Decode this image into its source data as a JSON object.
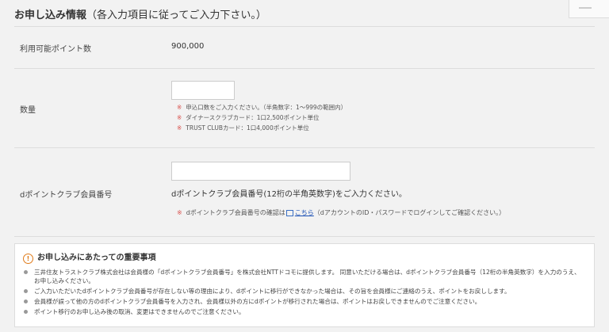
{
  "header": {
    "title": "お申し込み情報",
    "note": "（各入力項目に従ってご入力下さい。）"
  },
  "form": {
    "points": {
      "label": "利用可能ポイント数",
      "value": "900,000"
    },
    "quantity": {
      "label": "数量",
      "value": "",
      "notes": [
        "申込口数をご入力ください。（半角数字：1～999の範囲内）",
        "ダイナースクラブカード：1口2,500ポイント単位",
        "TRUST CLUBカード：1口4,000ポイント単位"
      ],
      "note_mark": "※"
    },
    "dpoint": {
      "label": "dポイントクラブ会員番号",
      "value": "",
      "description": "dポイントクラブ会員番号(12桁の半角英数字)をご入力ください。",
      "note_mark": "※",
      "note_prefix": "dポイントクラブ会員番号の確認は",
      "note_link": "こちら",
      "note_suffix": "（dアカウントのID・パスワードでログインしてご確認ください。）"
    }
  },
  "important": {
    "icon": "warning-circle-icon",
    "title": "お申し込みにあたっての重要事項",
    "items": [
      "三井住友トラストクラブ株式会社は会員様の「dポイントクラブ会員番号」を株式会社NTTドコモに提供します。 同意いただける場合は、dポイントクラブ会員番号（12桁の半角英数字）を入力のうえ、お申し込みください。",
      "ご入力いただいたdポイントクラブ会員番号が存在しない等の理由により、dポイントに移行ができなかった場合は、その旨を会員様にご連絡のうえ、ポイントをお戻しします。",
      "会員様が誤って他の方のdポイントクラブ会員番号を入力され、会員様以外の方にdポイントが移行された場合は、ポイントはお戻しできませんのでご注意ください。",
      "ポイント移行のお申し込み後の取消、変更はできませんのでご注意ください。"
    ]
  }
}
